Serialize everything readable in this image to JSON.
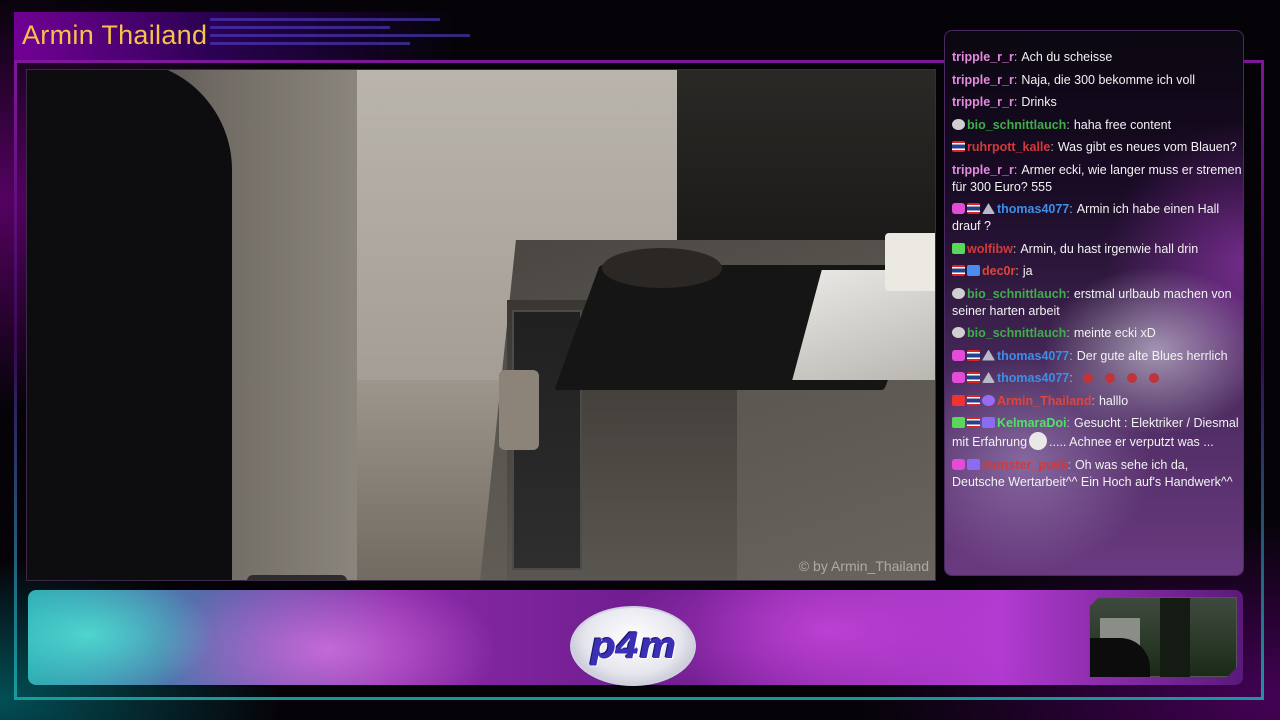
{
  "stream": {
    "streamer_name": "Armin Thailand",
    "watermark": "© by Armin_Thailand"
  },
  "logo": {
    "text": "p4m"
  },
  "chat": {
    "messages": [
      {
        "badges": [],
        "user": "tripple_r_r",
        "color": "#e68ae0",
        "text": "Ach du scheisse"
      },
      {
        "badges": [],
        "user": "tripple_r_r",
        "color": "#e68ae0",
        "text": "Naja, die 300 bekomme ich voll"
      },
      {
        "badges": [],
        "user": "tripple_r_r",
        "color": "#e68ae0",
        "text": "Drinks"
      },
      {
        "badges": [
          "mute"
        ],
        "user": "bio_schnittlauch",
        "color": "#3fae4a",
        "text": "haha free content"
      },
      {
        "badges": [
          "flag"
        ],
        "user": "ruhrpott_kalle",
        "color": "#d23a3a",
        "text": "Was gibt es neues vom Blauen?"
      },
      {
        "badges": [],
        "user": "tripple_r_r",
        "color": "#e68ae0",
        "text": "Armer ecki, wie langer muss er stremen für 300 Euro? 555"
      },
      {
        "badges": [
          "heart",
          "flag",
          "crown"
        ],
        "user": "thomas4077",
        "color": "#3d8ee8",
        "text": "Armin ich habe einen Hall drauf ?"
      },
      {
        "badges": [
          "green"
        ],
        "user": "wolfibw",
        "color": "#d23a3a",
        "text": "Armin, du hast irgenwie hall drin"
      },
      {
        "badges": [
          "flag",
          "gift"
        ],
        "user": "dec0r",
        "color": "#e0453a",
        "text": "ja"
      },
      {
        "badges": [
          "mute"
        ],
        "user": "bio_schnittlauch",
        "color": "#3fae4a",
        "text": "erstmal urlbaub machen von seiner harten arbeit"
      },
      {
        "badges": [
          "mute"
        ],
        "user": "bio_schnittlauch",
        "color": "#3fae4a",
        "text": "meinte ecki xD"
      },
      {
        "badges": [
          "heart",
          "flag",
          "crown"
        ],
        "user": "thomas4077",
        "color": "#3d8ee8",
        "text": "Der gute alte Blues herrlich"
      },
      {
        "badges": [
          "heart",
          "flag",
          "crown"
        ],
        "user": "thomas4077",
        "color": "#3d8ee8",
        "text": "",
        "emotes": 4
      },
      {
        "badges": [
          "cam",
          "flag",
          "check"
        ],
        "user": "Armin_Thailand",
        "color": "#e0453a",
        "text": "halllo"
      },
      {
        "badges": [
          "green",
          "flag",
          "vip"
        ],
        "user": "KelmaraDoi",
        "color": "#53e06a",
        "text": "Gesucht : Elektriker / Diesmal mit Erfahrung",
        "text2": "..... Achnee er verputzt was ...",
        "ghost": true
      },
      {
        "badges": [
          "heart",
          "vip"
        ],
        "user": "monster_pu66",
        "color": "#d23a3a",
        "text": "Oh was sehe ich da, Deutsche Wertarbeit^^ Ein Hoch auf's Handwerk^^"
      }
    ]
  }
}
